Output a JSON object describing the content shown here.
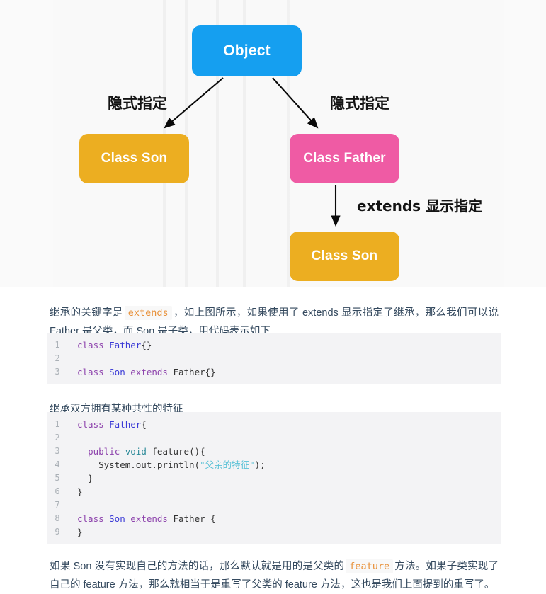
{
  "diagram": {
    "nodes": [
      {
        "id": "object",
        "label": "Object",
        "color": "#159ff0"
      },
      {
        "id": "son-left",
        "label": "Class Son",
        "color": "#ecae21"
      },
      {
        "id": "father",
        "label": "Class Father",
        "color": "#ef5ba4"
      },
      {
        "id": "son-right",
        "label": "Class Son",
        "color": "#ecae21"
      }
    ],
    "edges": [
      {
        "from": "object",
        "to": "son-left",
        "label": "隐式指定"
      },
      {
        "from": "object",
        "to": "father",
        "label": "隐式指定"
      },
      {
        "from": "father",
        "to": "son-right",
        "label": "extends 显示指定"
      }
    ],
    "labels": {
      "implicit_left": "隐式指定",
      "implicit_right": "隐式指定",
      "extends_explicit": "extends 显示指定"
    }
  },
  "paragraphs": {
    "p1": {
      "a": "继承的关键字是",
      "code": "extends",
      "b": "，如上图所示，如果使用了 extends 显示指定了继承，那么我们可以说 Father 是父类，而 Son 是子类，用代码表示如下"
    },
    "p2": {
      "text": "继承双方拥有某种共性的特征"
    },
    "p3": {
      "a": "如果 Son 没有实现自己的方法的话，那么默认就是用的是父类的",
      "code": "feature",
      "b": "方法。如果子类实现了自己的 feature 方法，那么就相当于是重写了父类的 feature 方法，这也是我们上面提到的重写了。"
    }
  },
  "code_blocks": [
    {
      "id": "code-block-1",
      "language": "java",
      "lines": [
        {
          "no": "1",
          "tokens": [
            {
              "t": "class ",
              "c": "kw"
            },
            {
              "t": "Father",
              "c": "cls"
            },
            {
              "t": "{}",
              "c": "plain"
            }
          ]
        },
        {
          "no": "2",
          "tokens": [
            {
              "t": "",
              "c": "plain"
            }
          ]
        },
        {
          "no": "3",
          "tokens": [
            {
              "t": "class ",
              "c": "kw"
            },
            {
              "t": "Son ",
              "c": "cls"
            },
            {
              "t": "extends ",
              "c": "kw"
            },
            {
              "t": "Father",
              "c": "plain"
            },
            {
              "t": "{}",
              "c": "plain"
            }
          ]
        }
      ]
    },
    {
      "id": "code-block-2",
      "language": "java",
      "lines": [
        {
          "no": "1",
          "tokens": [
            {
              "t": "class ",
              "c": "kw"
            },
            {
              "t": "Father",
              "c": "cls"
            },
            {
              "t": "{",
              "c": "plain"
            }
          ]
        },
        {
          "no": "2",
          "tokens": [
            {
              "t": "",
              "c": "plain"
            }
          ]
        },
        {
          "no": "3",
          "tokens": [
            {
              "t": "  ",
              "c": "plain"
            },
            {
              "t": "public ",
              "c": "kw"
            },
            {
              "t": "void ",
              "c": "type"
            },
            {
              "t": "feature",
              "c": "plain"
            },
            {
              "t": "(){",
              "c": "plain"
            }
          ]
        },
        {
          "no": "4",
          "tokens": [
            {
              "t": "    System.out.println(",
              "c": "plain"
            },
            {
              "t": "\"父亲的特征\"",
              "c": "str"
            },
            {
              "t": ");",
              "c": "plain"
            }
          ]
        },
        {
          "no": "5",
          "tokens": [
            {
              "t": "  }",
              "c": "plain"
            }
          ]
        },
        {
          "no": "6",
          "tokens": [
            {
              "t": "}",
              "c": "plain"
            }
          ]
        },
        {
          "no": "7",
          "tokens": [
            {
              "t": "",
              "c": "plain"
            }
          ]
        },
        {
          "no": "8",
          "tokens": [
            {
              "t": "class ",
              "c": "kw"
            },
            {
              "t": "Son ",
              "c": "cls"
            },
            {
              "t": "extends ",
              "c": "kw"
            },
            {
              "t": "Father {",
              "c": "plain"
            }
          ]
        },
        {
          "no": "9",
          "tokens": [
            {
              "t": "}",
              "c": "plain"
            }
          ]
        }
      ]
    }
  ],
  "colors": {
    "object_blue": "#159ff0",
    "son_amber": "#ecae21",
    "father_pink": "#ef5ba4",
    "inline_code_orange": "#e8913a",
    "code_bg": "#f3f3f5",
    "body_text": "#34495e"
  }
}
